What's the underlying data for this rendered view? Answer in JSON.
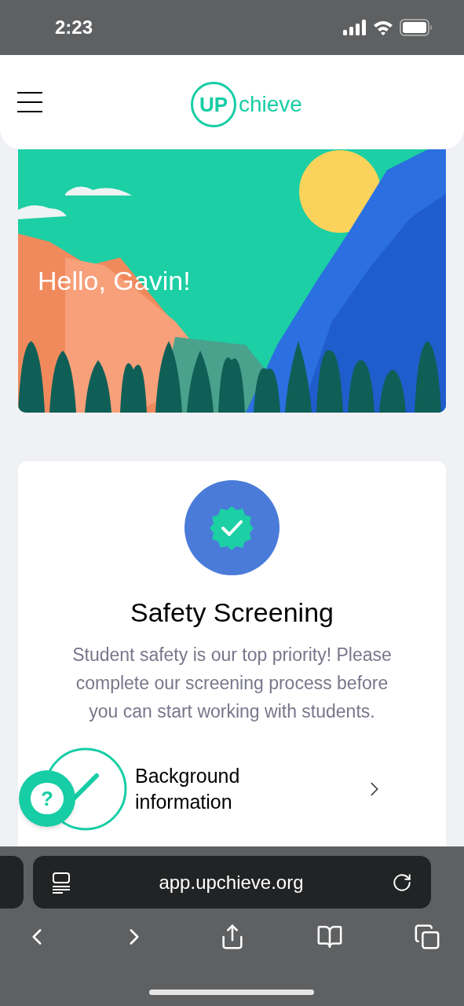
{
  "status_bar": {
    "time": "2:23"
  },
  "header": {
    "logo_mark": "UP",
    "logo_text": "chieve"
  },
  "hero": {
    "greeting": "Hello, Gavin!"
  },
  "screening_card": {
    "title": "Safety Screening",
    "description": "Student safety is our top priority! Please complete our screening process before you can start working with students.",
    "steps": [
      {
        "label": "Background information",
        "completed": true
      }
    ]
  },
  "help_button": {
    "symbol": "?"
  },
  "browser": {
    "url": "app.upchieve.org"
  }
}
